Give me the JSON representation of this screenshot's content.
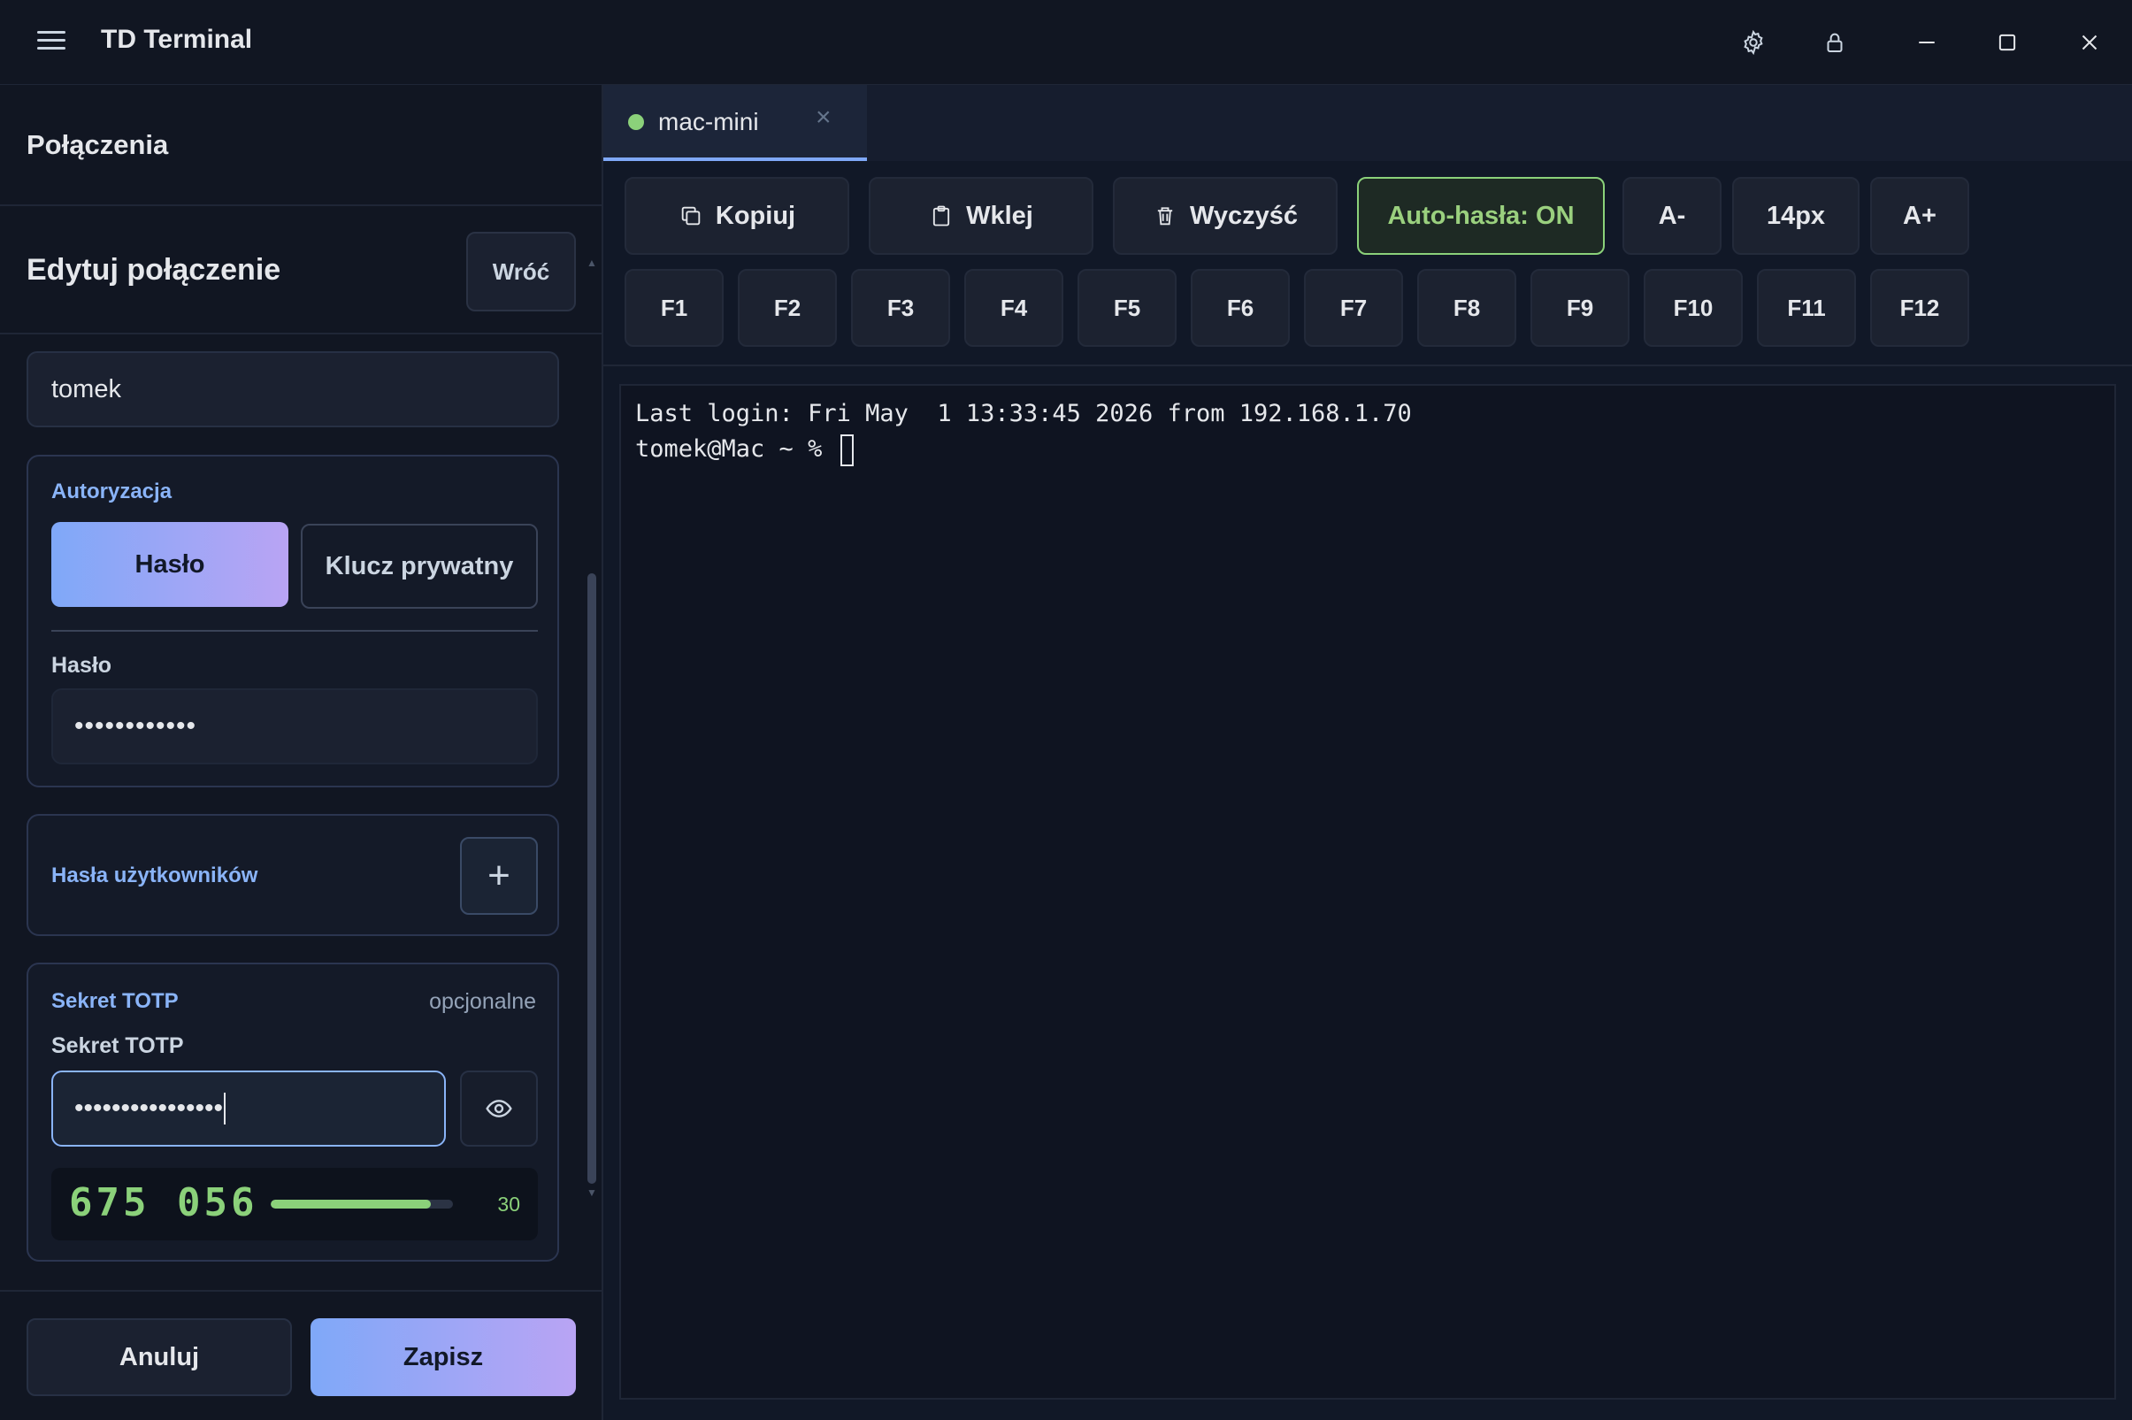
{
  "app": {
    "title": "TD Terminal"
  },
  "colors": {
    "accent": "#7fa8f8",
    "accent_end": "#b9a4f4",
    "success": "#8bd17a",
    "background": "#111827",
    "panel": "#111622"
  },
  "titlebar_icons": [
    "menu-icon",
    "gear-icon",
    "lock-icon",
    "minimize-icon",
    "maximize-icon",
    "close-icon"
  ],
  "sidebar": {
    "header": "Połączenia",
    "edit_title": "Edytuj połączenie",
    "back_label": "Wróć",
    "username_value": "tomek",
    "auth": {
      "label": "Autoryzacja",
      "option_password": "Hasło",
      "option_key": "Klucz prywatny",
      "password_label": "Hasło",
      "password_value": "••••••••••••"
    },
    "user_passwords": {
      "label": "Hasła użytkowników",
      "add_symbol": "+"
    },
    "totp": {
      "label": "Sekret TOTP",
      "optional": "opcjonalne",
      "field_label": "Sekret TOTP",
      "value": "••••••••••••••••",
      "code": "675 056",
      "seconds": "30",
      "progress": 0.88
    },
    "cancel_label": "Anuluj",
    "save_label": "Zapisz"
  },
  "tabs": [
    {
      "label": "mac-mini",
      "status": "connected",
      "close": "×"
    }
  ],
  "toolbar": {
    "copy": "Kopiuj",
    "paste": "Wklej",
    "clear": "Wyczyść",
    "auto_passwords": "Auto-hasła: ON",
    "font_smaller": "A-",
    "font_size": "14px",
    "font_larger": "A+",
    "fkeys": [
      "F1",
      "F2",
      "F3",
      "F4",
      "F5",
      "F6",
      "F7",
      "F8",
      "F9",
      "F10",
      "F11",
      "F12"
    ]
  },
  "terminal": {
    "line1": "Last login: Fri May  1 13:33:45 2026 from 192.168.1.70",
    "prompt": "tomek@Mac ~ % "
  }
}
